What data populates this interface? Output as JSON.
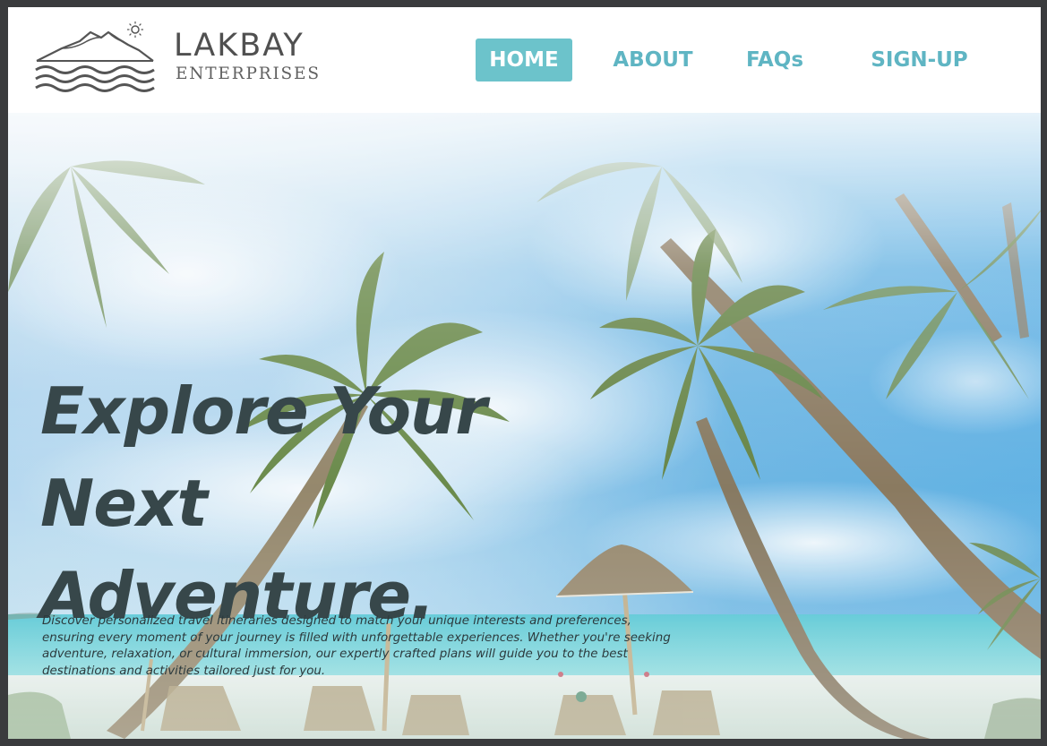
{
  "brand": {
    "name": "LAKBAY",
    "tagline": "ENTERPRISES",
    "logo_icon": "mountain-waves-sun-logo"
  },
  "nav": {
    "items": [
      {
        "label": "HOME",
        "active": true
      },
      {
        "label": "ABOUT",
        "active": false
      },
      {
        "label": "FAQs",
        "active": false
      },
      {
        "label": "SIGN-UP",
        "active": false
      }
    ]
  },
  "hero": {
    "heading_lines": [
      "Explore Your",
      "Next",
      "Adventure."
    ],
    "description": "Discover personalized travel itineraries designed to match your unique interests and preferences, ensuring every moment of your journey is filled with unforgettable experiences. Whether you're seeking adventure, relaxation, or cultural immersion, our expertly crafted plans will guide you to the best destinations and activities tailored just for you.",
    "background": "tropical-beach-palm-trees"
  },
  "colors": {
    "accent": "#6cc3cb",
    "nav_text": "#5fb5c3",
    "heading": "#37474a",
    "frame": "#3a3b3d"
  }
}
